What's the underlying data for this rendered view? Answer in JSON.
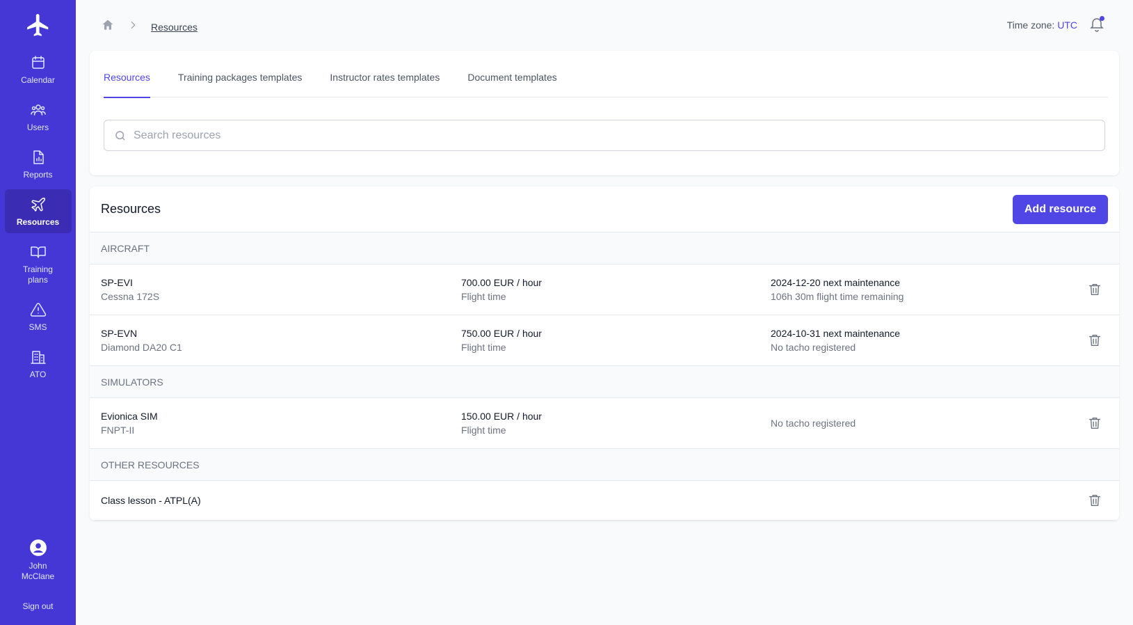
{
  "sidebar": {
    "logo": "airplane-logo",
    "items": [
      {
        "label": "Calendar",
        "icon": "calendar-icon"
      },
      {
        "label": "Users",
        "icon": "users-icon"
      },
      {
        "label": "Reports",
        "icon": "report-icon"
      },
      {
        "label": "Resources",
        "icon": "plane-icon",
        "active": true
      },
      {
        "label": "Training plans",
        "icon": "book-icon"
      },
      {
        "label": "SMS",
        "icon": "warning-icon"
      },
      {
        "label": "ATO",
        "icon": "building-icon"
      }
    ],
    "user": {
      "name": "John McClane",
      "icon": "user-circle-icon"
    },
    "sign_out": "Sign out"
  },
  "header": {
    "breadcrumb": {
      "home_icon": "home-icon",
      "current": "Resources"
    },
    "timezone_label": "Time zone:",
    "timezone_value": "UTC",
    "bell_icon": "bell-icon"
  },
  "tabs": [
    {
      "label": "Resources",
      "active": true
    },
    {
      "label": "Training packages templates"
    },
    {
      "label": "Instructor rates templates"
    },
    {
      "label": "Document templates"
    }
  ],
  "search": {
    "placeholder": "Search resources",
    "value": ""
  },
  "resources": {
    "title": "Resources",
    "add_button": "Add resource",
    "sections": [
      {
        "heading": "AIRCRAFT",
        "rows": [
          {
            "name": "SP-EVI",
            "model": "Cessna 172S",
            "rate": "700.00 EUR / hour",
            "rate_basis": "Flight time",
            "maintenance": "2024-12-20 next maintenance",
            "tacho": "106h 30m flight time remaining"
          },
          {
            "name": "SP-EVN",
            "model": "Diamond DA20 C1",
            "rate": "750.00 EUR / hour",
            "rate_basis": "Flight time",
            "maintenance": "2024-10-31 next maintenance",
            "tacho": "No tacho registered"
          }
        ]
      },
      {
        "heading": "SIMULATORS",
        "rows": [
          {
            "name": "Evionica SIM",
            "model": "FNPT-II",
            "rate": "150.00 EUR / hour",
            "rate_basis": "Flight time",
            "maintenance": "",
            "tacho": "No tacho registered"
          }
        ]
      },
      {
        "heading": "OTHER RESOURCES",
        "rows": [
          {
            "name": "Class lesson - ATPL(A)"
          }
        ]
      }
    ]
  },
  "colors": {
    "sidebar": "#4537d6",
    "accent": "#4f46e5"
  }
}
